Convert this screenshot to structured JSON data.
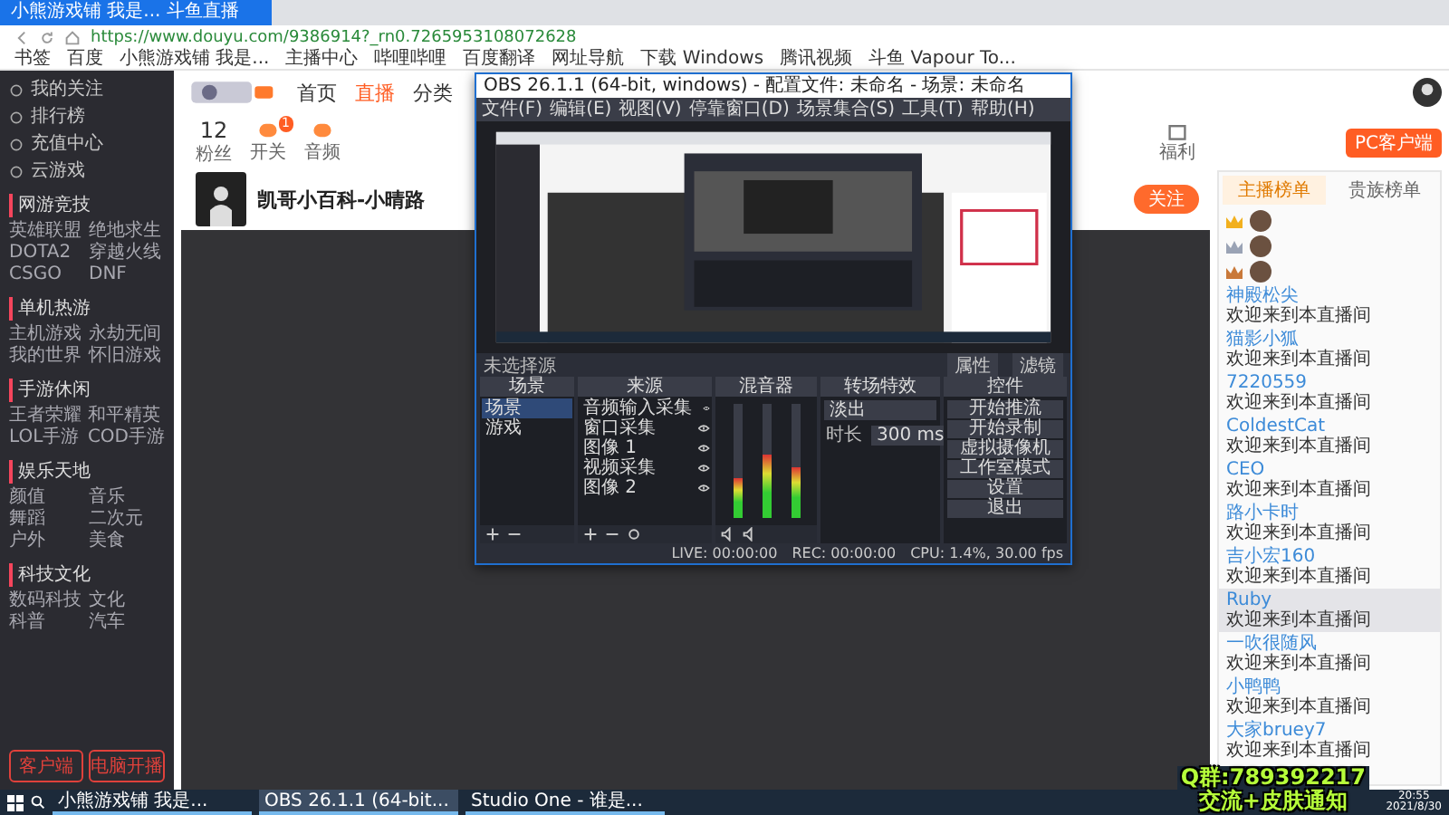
{
  "browser": {
    "tabs": [
      {
        "title": "小熊游戏铺 我是... 斗鱼直播",
        "selected": true
      }
    ],
    "url": "https://www.douyu.com/9386914?_rn0.7265953108072628",
    "bookmarks": [
      "书签",
      "百度",
      "小熊游戏铺 我是...",
      "主播中心",
      "哔哩哔哩",
      "百度翻译",
      "网址导航",
      "下载 Windows",
      "腾讯视频",
      "斗鱼 Vapour To..."
    ]
  },
  "sidebar": {
    "items": [
      {
        "label": "我的关注"
      },
      {
        "label": "排行榜"
      },
      {
        "label": "充值中心"
      },
      {
        "label": "云游戏"
      }
    ],
    "sections": [
      {
        "title": "网游竞技",
        "items": [
          "英雄联盟",
          "绝地求生",
          "DOTA2",
          "穿越火线",
          "CSGO",
          "DNF"
        ]
      },
      {
        "title": "单机热游",
        "items": [
          "主机游戏",
          "永劫无间",
          "我的世界",
          "怀旧游戏"
        ]
      },
      {
        "title": "手游休闲",
        "items": [
          "王者荣耀",
          "和平精英",
          "LOL手游",
          "COD手游"
        ]
      },
      {
        "title": "娱乐天地",
        "items": [
          "颜值",
          "音乐",
          "舞蹈",
          "二次元",
          "户外",
          "美食"
        ]
      },
      {
        "title": "科技文化",
        "items": [
          "数码科技",
          "文化",
          "科普",
          "汽车"
        ]
      }
    ],
    "buttons": [
      "客户端",
      "电脑开播"
    ]
  },
  "site": {
    "nav": [
      {
        "label": "首页",
        "selected": false
      },
      {
        "label": "直播",
        "selected": true
      },
      {
        "label": "分类",
        "selected": false
      }
    ],
    "toolbar": [
      {
        "value": "12",
        "label": "粉丝"
      },
      {
        "label": "开关",
        "badge": "1"
      },
      {
        "label": "音频"
      }
    ],
    "toolbar_right": [
      {
        "label": "福利"
      }
    ],
    "pc_client": "PC客户端",
    "streamer": {
      "name": "凯哥小百科-小晴路"
    },
    "follow": "关注"
  },
  "chat": {
    "tabs": [
      {
        "label": "主播榜单",
        "selected": true
      },
      {
        "label": "贵族榜单",
        "selected": false
      }
    ],
    "top_fans": [
      {
        "color": "#f2b01e"
      },
      {
        "color": "#9aa3b5"
      },
      {
        "color": "#c9793a"
      }
    ],
    "messages": [
      {
        "name": "神殿松尖",
        "text": "欢迎来到本直播间",
        "highlight": false
      },
      {
        "name": "猫影小狐",
        "text": "欢迎来到本直播间",
        "highlight": false
      },
      {
        "name": "7220559",
        "text": "欢迎来到本直播间",
        "highlight": false
      },
      {
        "name": "ColdestCat",
        "text": "欢迎来到本直播间",
        "highlight": false
      },
      {
        "name": "CEO",
        "text": "欢迎来到本直播间",
        "highlight": false
      },
      {
        "name": "路小卡时",
        "text": "欢迎来到本直播间",
        "highlight": false
      },
      {
        "name": "吉小宏160",
        "text": "欢迎来到本直播间",
        "highlight": false
      },
      {
        "name": "Ruby",
        "text": "欢迎来到本直播间",
        "highlight": true
      },
      {
        "name": "一吹很随风",
        "text": "欢迎来到本直播间",
        "highlight": false
      },
      {
        "name": "小鸭鸭",
        "text": "欢迎来到本直播间",
        "highlight": false
      },
      {
        "name": "大家bruey7",
        "text": "欢迎来到本直播间",
        "highlight": false
      }
    ]
  },
  "obs": {
    "title": "OBS 26.1.1 (64-bit, windows) - 配置文件: 未命名 - 场景: 未命名",
    "menu": [
      "文件(F)",
      "编辑(E)",
      "视图(V)",
      "停靠窗口(D)",
      "场景集合(S)",
      "工具(T)",
      "帮助(H)"
    ],
    "no_source": "未选择源",
    "source_buttons": [
      "属性",
      "滤镜"
    ],
    "docks": [
      "场景",
      "来源",
      "混音器",
      "转场特效",
      "控件"
    ],
    "scenes": [
      {
        "label": "场景",
        "selected": true
      },
      {
        "label": "游戏",
        "selected": false
      }
    ],
    "sources": [
      "音频输入采集",
      "窗口采集",
      "图像 1",
      "视频采集",
      "图像 2"
    ],
    "mixer": [
      {
        "level": 0.35
      },
      {
        "level": 0.55
      },
      {
        "level": 0.45
      }
    ],
    "transition": {
      "type": "淡出",
      "duration_label": "时长",
      "duration": "300 ms"
    },
    "controls": [
      "开始推流",
      "开始录制",
      "虚拟摄像机",
      "工作室模式",
      "设置",
      "退出"
    ],
    "status": [
      "LIVE: 00:00:00",
      "REC: 00:00:00",
      "CPU: 1.4%, 30.00 fps"
    ]
  },
  "overlay": [
    "Q群:789392217",
    "交流+皮肤通知"
  ],
  "taskbar": {
    "apps": [
      {
        "label": "小熊游戏铺 我是...",
        "selected": false
      },
      {
        "label": "OBS 26.1.1 (64-bit...",
        "selected": true
      },
      {
        "label": "Studio One - 谁是...",
        "selected": false
      }
    ],
    "time": "20:55",
    "date": "2021/8/30"
  }
}
